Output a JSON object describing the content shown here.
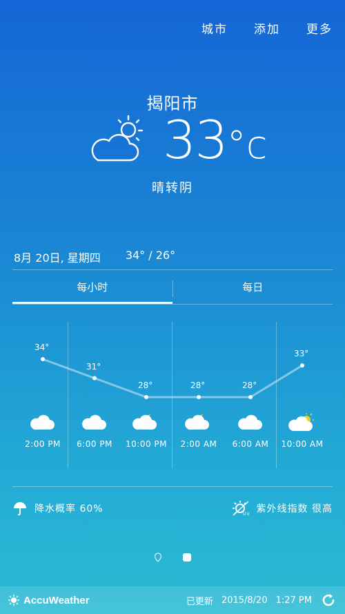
{
  "top_menu": {
    "city": "城市",
    "add": "添加",
    "more": "更多"
  },
  "current": {
    "city": "揭阳市",
    "temp": "33",
    "unit": "°c",
    "condition": "晴转阴",
    "icon": "partly-cloudy-sun-icon"
  },
  "date_row": {
    "date": "8月 20日, 星期四",
    "range": "34° / 26°"
  },
  "tabs": [
    {
      "label": "每小时",
      "active": true
    },
    {
      "label": "每日",
      "active": false
    }
  ],
  "hourly": [
    {
      "time": "2:00 PM",
      "temp": "34°",
      "icon": "cloud-icon"
    },
    {
      "time": "6:00 PM",
      "temp": "31°",
      "icon": "cloud-icon"
    },
    {
      "time": "10:00 PM",
      "temp": "28°",
      "icon": "moon-cloud-icon"
    },
    {
      "time": "2:00 AM",
      "temp": "28°",
      "icon": "moon-cloud-icon"
    },
    {
      "time": "6:00 AM",
      "temp": "28°",
      "icon": "cloud-icon"
    },
    {
      "time": "10:00 AM",
      "temp": "33°",
      "icon": "sun-cloud-icon"
    }
  ],
  "bottom": {
    "rain_label": "降水概率 60%",
    "uv_label": "紫外线指数 很高"
  },
  "footer": {
    "brand": "AccuWeather",
    "updated": "已更新",
    "date": "2015/8/20",
    "time": "1:27 PM"
  }
}
